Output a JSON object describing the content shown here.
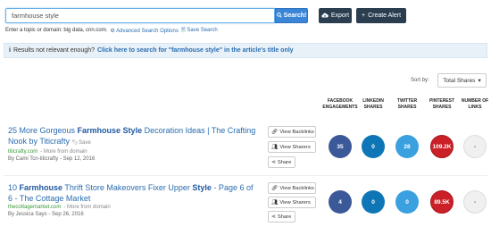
{
  "search": {
    "value": "farmhouse style",
    "button_label": "Search!",
    "hint_text": "Enter a topic or domain: big data, cnn.com.",
    "advanced_label": "Advanced Search Options",
    "save_search_label": "Save Search"
  },
  "toolbar": {
    "export_label": "Export",
    "alert_label": "Create Alert"
  },
  "notice": {
    "lead": "Results not relevant enough?",
    "link": "Click here to search for \"farmhouse style\" in the article's title only"
  },
  "sort": {
    "label": "Sort by:",
    "selected": "Total Shares"
  },
  "columns": {
    "facebook": "FACEBOOK ENGAGEMENTS",
    "linkedin": "LINKEDIN SHARES",
    "twitter": "TWITTER SHARES",
    "pinterest": "PINTEREST SHARES",
    "links": "NUMBER OF LINKS"
  },
  "actions": {
    "backlinks": "View Backlinks",
    "sharers": "View Sharers",
    "share": "Share"
  },
  "results": [
    {
      "title_pre": "25 More Gorgeous ",
      "title_bold": "Farmhouse Style",
      "title_post": " Decoration Ideas | The Crafting Nook by Titicrafty",
      "save": "Save",
      "domain": "titicrafty.com",
      "more": "- More from domain",
      "byline": "By Cami Tcn-titicrafty - Sep 12, 2016",
      "facebook": "35",
      "linkedin": "0",
      "twitter": "28",
      "pinterest": "109.2K",
      "links": "-"
    },
    {
      "title_pre": "10 ",
      "title_bold": "Farmhouse",
      "title_mid": " Thrift Store Makeovers Fixer Upper ",
      "title_bold2": "Style",
      "title_post": " - Page 6 of 6 - The Cottage Market",
      "save": "Save",
      "domain": "thecottagemarket.com",
      "more": "- More from domain",
      "byline": "By Jessica Says - Sep 26, 2016",
      "facebook": "4",
      "linkedin": "0",
      "twitter": "0",
      "pinterest": "89.5K",
      "links": "-"
    }
  ],
  "colors": {
    "accent": "#3a85d6",
    "toolbar_dark": "#2b3e50",
    "facebook": "#3b5998",
    "linkedin": "#0e76b6",
    "twitter": "#3aa0e0",
    "pinterest": "#cb2027"
  }
}
